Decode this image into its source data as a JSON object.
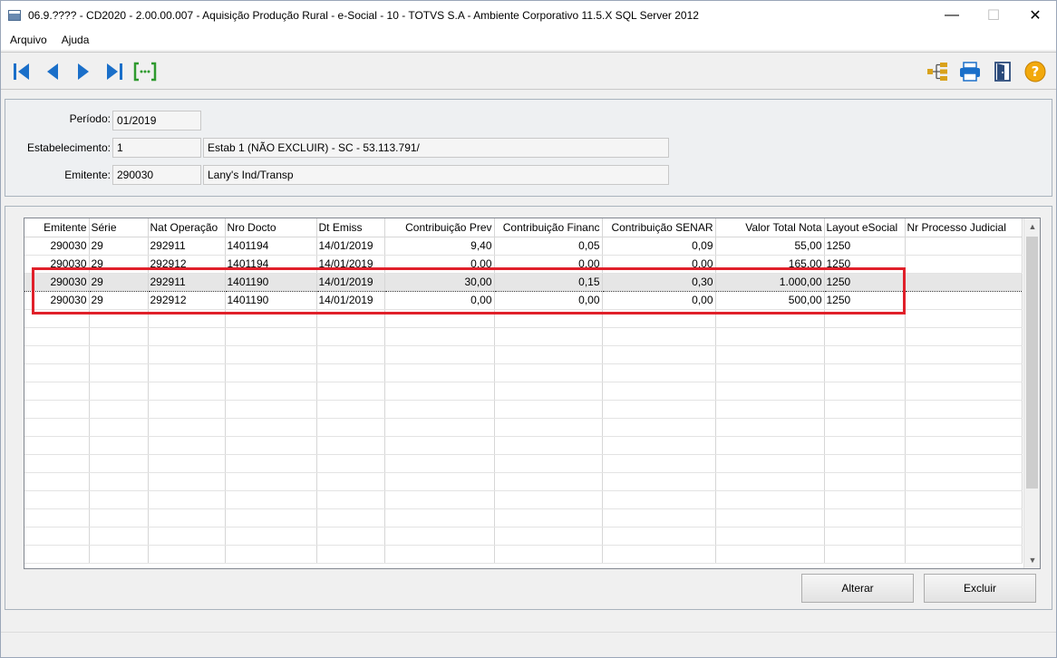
{
  "window": {
    "title": "06.9.???? - CD2020 - 2.00.00.007 - Aquisição Produção Rural - e-Social - 10 - TOTVS S.A - Ambiente Corporativo 11.5.X SQL Server 2012",
    "minimize": "—",
    "maximize": "☐",
    "close": "✕"
  },
  "menu": {
    "items": [
      "Arquivo",
      "Ajuda"
    ]
  },
  "toolbar": {
    "left_icons": [
      "first-record-icon",
      "previous-record-icon",
      "next-record-icon",
      "last-record-icon",
      "goto-icon"
    ],
    "right_icons": [
      "tree-icon",
      "print-icon",
      "exit-door-icon",
      "help-icon"
    ],
    "accent": "#1a6fc9"
  },
  "header": {
    "periodo": {
      "label": "Período:",
      "value": "01/2019"
    },
    "estabelecimento": {
      "label": "Estabelecimento:",
      "code": "1",
      "description": "Estab 1 (NÃO EXCLUIR) - SC - 53.113.791/"
    },
    "emitente": {
      "label": "Emitente:",
      "code": "290030",
      "name": "Lany's Ind/Transp"
    }
  },
  "grid": {
    "columns": [
      "Emitente",
      "Série",
      "Nat Operação",
      "Nro Docto",
      "Dt Emiss",
      "Contribuição Prev",
      "Contribuição Financ",
      "Contribuição SENAR",
      "Valor Total Nota",
      "Layout eSocial",
      "Nr Processo Judicial"
    ],
    "rows": [
      [
        "290030",
        "29",
        "292911",
        "1401194",
        "14/01/2019",
        "9,40",
        "0,05",
        "0,09",
        "55,00",
        "1250",
        ""
      ],
      [
        "290030",
        "29",
        "292912",
        "1401194",
        "14/01/2019",
        "0,00",
        "0,00",
        "0,00",
        "165,00",
        "1250",
        ""
      ],
      [
        "290030",
        "29",
        "292911",
        "1401190",
        "14/01/2019",
        "30,00",
        "0,15",
        "0,30",
        "1.000,00",
        "1250",
        ""
      ],
      [
        "290030",
        "29",
        "292912",
        "1401190",
        "14/01/2019",
        "0,00",
        "0,00",
        "0,00",
        "500,00",
        "1250",
        ""
      ]
    ],
    "selected_row": 2,
    "highlight_color": "#e0202a"
  },
  "buttons": {
    "alterar": "Alterar",
    "excluir": "Excluir"
  }
}
